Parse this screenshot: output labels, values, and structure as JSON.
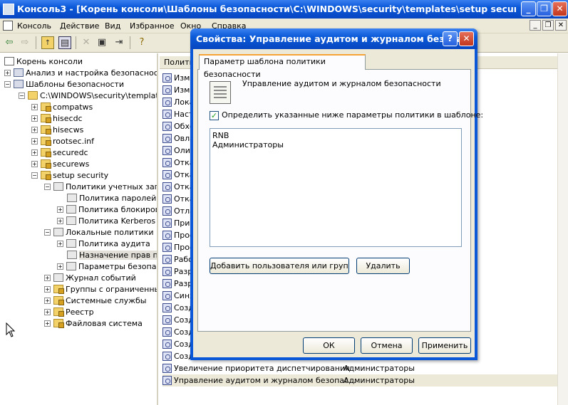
{
  "main_window": {
    "title": "Консоль3 - [Корень консоли\\Шаблоны безопасности\\C:\\WINDOWS\\security\\templates\\setup security\\Локальн...",
    "caption_buttons": {
      "minimize": "_",
      "maximize": "❐",
      "close": "✕"
    }
  },
  "menu": {
    "items": [
      "Консоль",
      "Действие",
      "Вид",
      "Избранное",
      "Окно",
      "Справка"
    ],
    "mdi_buttons": {
      "minimize": "_",
      "restore": "❐",
      "close": "✕"
    }
  },
  "toolbar": {
    "icons": [
      "back-arrow-icon",
      "forward-arrow-icon",
      "up-folder-icon",
      "show-hide-tree-icon",
      "delete-icon",
      "properties-icon",
      "export-list-icon",
      "help-icon"
    ]
  },
  "tree": {
    "nodes": [
      {
        "label": "Корень консоли",
        "expander": ""
      },
      {
        "label": "Анализ и настройка безопасности",
        "expander": "+"
      },
      {
        "label": "Шаблоны безопасности",
        "expander": "−"
      },
      {
        "label": "C:\\WINDOWS\\security\\templates",
        "expander": "−"
      },
      {
        "label": "compatws",
        "expander": "+"
      },
      {
        "label": "hisecdc",
        "expander": "+"
      },
      {
        "label": "hisecws",
        "expander": "+"
      },
      {
        "label": "rootsec.inf",
        "expander": "+"
      },
      {
        "label": "securedc",
        "expander": "+"
      },
      {
        "label": "securews",
        "expander": "+"
      },
      {
        "label": "setup security",
        "expander": "−"
      },
      {
        "label": "Политики учетных записей",
        "expander": "−"
      },
      {
        "label": "Политика паролей",
        "expander": ""
      },
      {
        "label": "Политика блокировки",
        "expander": "+"
      },
      {
        "label": "Политика Kerberos",
        "expander": "+"
      },
      {
        "label": "Локальные политики",
        "expander": "−"
      },
      {
        "label": "Политика аудита",
        "expander": "+"
      },
      {
        "label": "Назначение прав пользователя",
        "expander": ""
      },
      {
        "label": "Параметры безопасности",
        "expander": "+"
      },
      {
        "label": "Журнал событий",
        "expander": "+"
      },
      {
        "label": "Группы с ограниченным доступом",
        "expander": "+"
      },
      {
        "label": "Системные службы",
        "expander": "+"
      },
      {
        "label": "Реестр",
        "expander": "+"
      },
      {
        "label": "Файловая система",
        "expander": "+"
      }
    ]
  },
  "list": {
    "header": "Полити",
    "rows": [
      {
        "name": "Изме",
        "value": ""
      },
      {
        "name": "Изме",
        "value": ""
      },
      {
        "name": "Лока",
        "value": ""
      },
      {
        "name": "Наст",
        "value": ""
      },
      {
        "name": "Обхо",
        "value": ""
      },
      {
        "name": "Овла",
        "value": ""
      },
      {
        "name": "Оли",
        "value": ""
      },
      {
        "name": "Отка",
        "value": ""
      },
      {
        "name": "Отка",
        "value": ""
      },
      {
        "name": "Отка",
        "value": ""
      },
      {
        "name": "Отка",
        "value": ""
      },
      {
        "name": "Отла",
        "value": ""
      },
      {
        "name": "Прим",
        "value": ""
      },
      {
        "name": "Проф",
        "value": ""
      },
      {
        "name": "Проф",
        "value": ""
      },
      {
        "name": "Рабо",
        "value": ""
      },
      {
        "name": "Разр",
        "value": ""
      },
      {
        "name": "Разр",
        "value": ""
      },
      {
        "name": "Синх",
        "value": ""
      },
      {
        "name": "Созд",
        "value": ""
      },
      {
        "name": "Созд",
        "value": ""
      },
      {
        "name": "Созд",
        "value": ""
      },
      {
        "name": "Созд",
        "value": ""
      },
      {
        "name": "Созд",
        "value": ""
      },
      {
        "name": "Увеличение приоритета диспетчирования",
        "value": "Администраторы"
      },
      {
        "name": "Управление аудитом и журналом безопас...",
        "value": "Администраторы"
      }
    ]
  },
  "dialog": {
    "title": "Свойства: Управление аудитом и журналом безопа...",
    "help_button": "?",
    "close_button": "✕",
    "tab_label": "Параметр шаблона политики безопасности",
    "policy_name": "Управление аудитом и журналом безопасности",
    "checkbox_label": "Определить указанные ниже параметры политики в шаблоне:",
    "checkbox_checked": true,
    "members": [
      "RNB",
      "Администраторы"
    ],
    "add_button": "Добавить пользователя или группу...",
    "remove_button": "Удалить",
    "ok_button": "ОК",
    "cancel_button": "Отмена",
    "apply_button": "Применить"
  }
}
